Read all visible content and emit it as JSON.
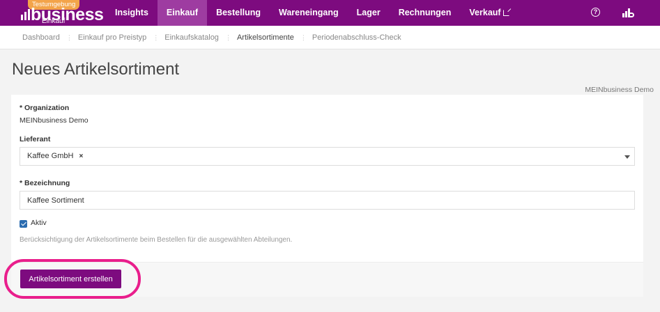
{
  "app": {
    "badge": "Testumgebung",
    "logo_word": "business",
    "logo_sub": "Einkauf"
  },
  "nav": {
    "items": [
      {
        "label": "Insights",
        "active": false
      },
      {
        "label": "Einkauf",
        "active": true
      },
      {
        "label": "Bestellung",
        "active": false
      },
      {
        "label": "Wareneingang",
        "active": false
      },
      {
        "label": "Lager",
        "active": false
      },
      {
        "label": "Rechnungen",
        "active": false
      },
      {
        "label": "Verkauf",
        "active": false,
        "icon": "external-link-icon"
      }
    ],
    "help_icon": "?",
    "right_icons": [
      "help-icon",
      "stats-icon"
    ]
  },
  "breadcrumb": {
    "items": [
      "Dashboard",
      "Einkauf pro Preistyp",
      "Einkaufskatalog",
      "Artikelsortimente",
      "Periodenabschluss-Check"
    ],
    "current": "Artikelsortimente"
  },
  "page": {
    "title": "Neues Artikelsortiment",
    "owner": "MEINbusiness Demo"
  },
  "form": {
    "organization_label": "* Organization",
    "organization_value": "MEINbusiness Demo",
    "supplier_label": "Lieferant",
    "supplier_tag": "Kaffee GmbH",
    "supplier_tag_remove": "×",
    "name_label": "* Bezeichnung",
    "name_value": "Kaffee Sortiment",
    "active_label": "Aktiv",
    "active_checked": true,
    "hint": "Berücksichtigung der Artikelsortimente beim Bestellen für die ausgewählten Abteilungen."
  },
  "actions": {
    "create_label": "Artikelsortiment erstellen"
  },
  "colors": {
    "brand": "#7d0b7f",
    "nav_active": "#9e3ca1",
    "badge": "#f3a44a",
    "highlight": "#e91e8c",
    "checkbox": "#2b6cb0"
  }
}
